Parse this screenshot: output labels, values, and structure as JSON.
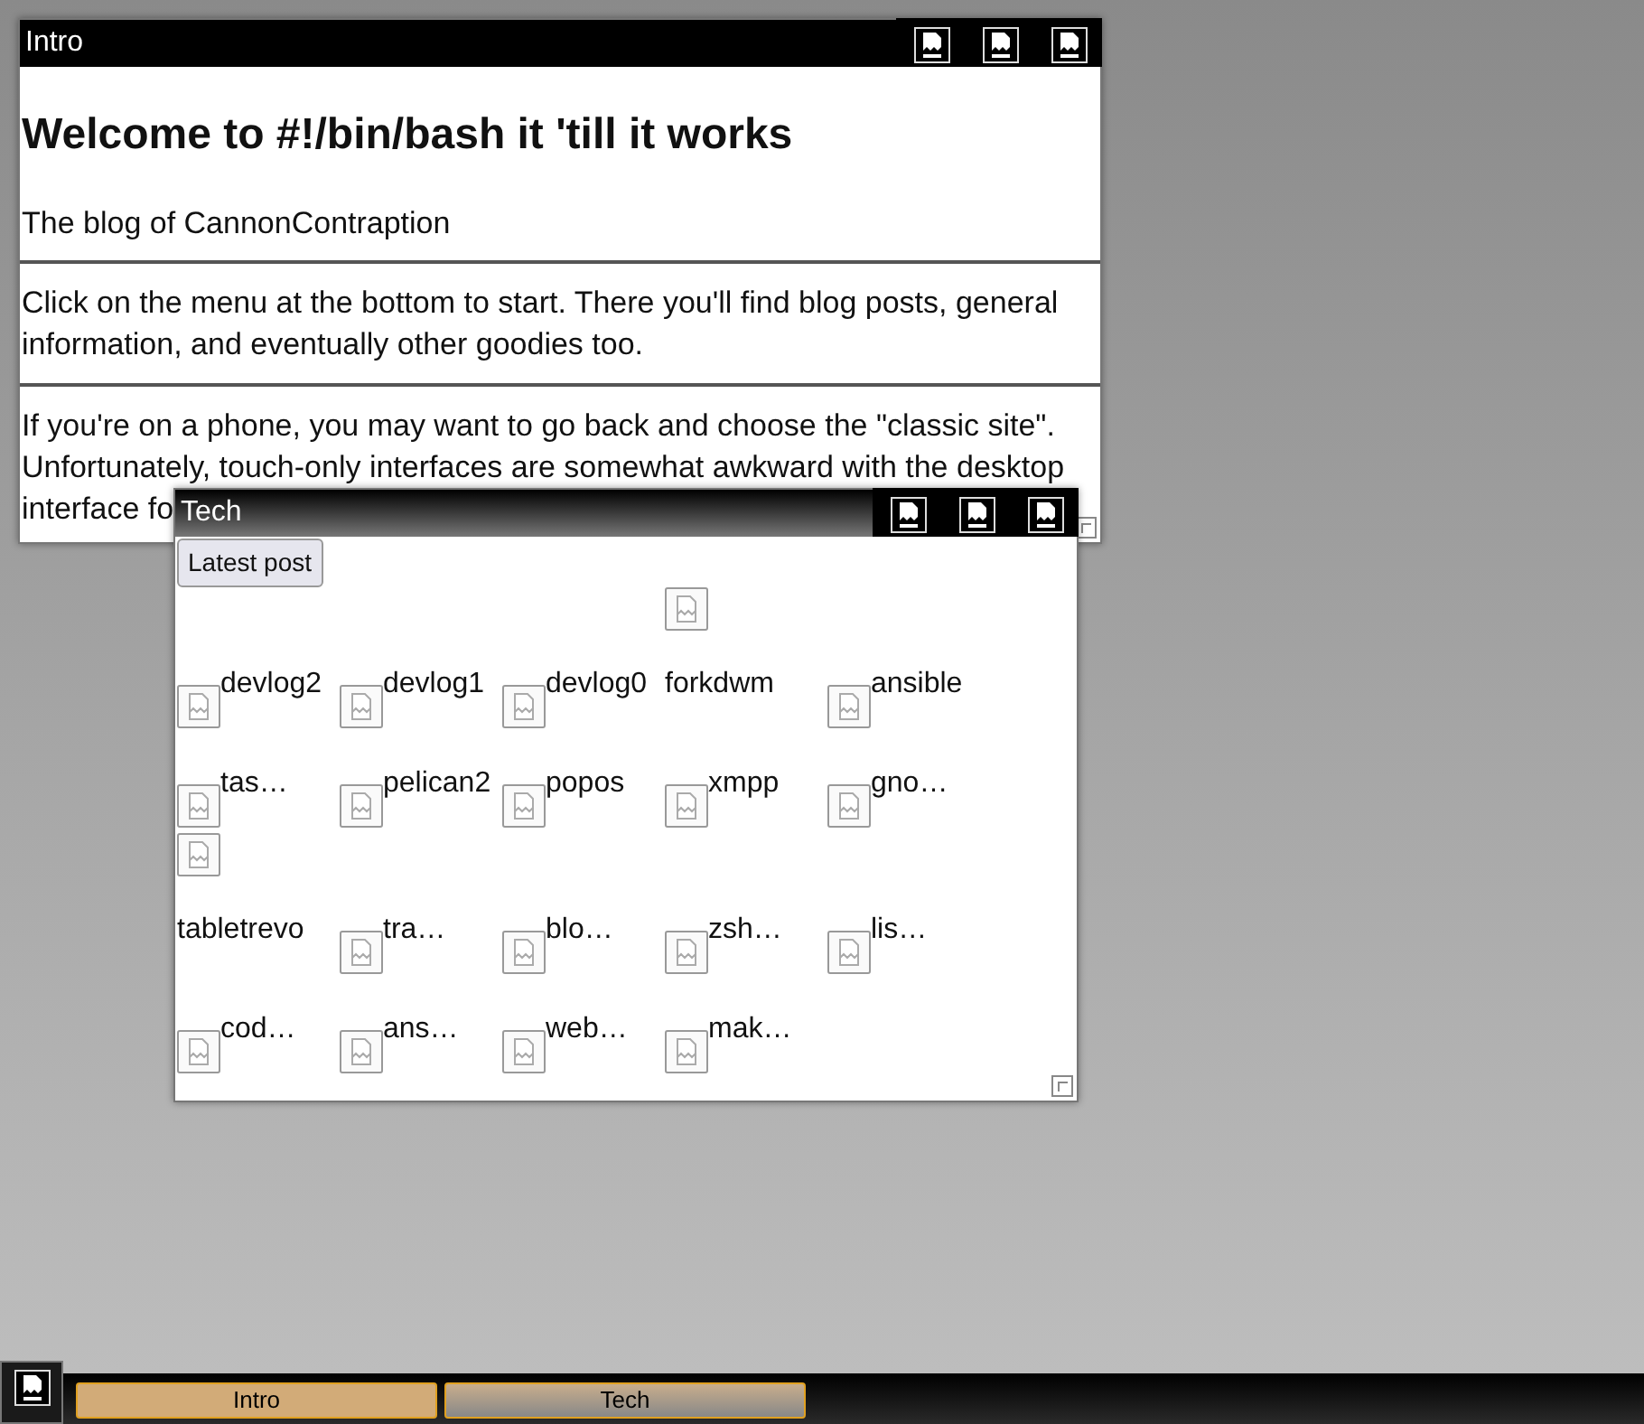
{
  "windows": [
    {
      "title": "Intro",
      "active": false,
      "heading": "Welcome to #!/bin/bash it 'till it works",
      "sections": [
        "The blog of CannonContraption",
        "Click on the menu at the bottom to start. There you'll find blog posts, general information, and eventually other goodies too.",
        "If you're on a phone, you may want to go back and choose the \"classic site\". Unfortunately, touch-only interfaces are somewhat awkward with the desktop interface fo"
      ]
    },
    {
      "title": "Tech",
      "active": true,
      "button": "Latest post",
      "grid_rows": [
        [
          {
            "kind": "blank"
          },
          {
            "kind": "blank"
          },
          {
            "kind": "blank"
          },
          {
            "kind": "image"
          },
          {
            "kind": "blank"
          }
        ],
        [
          {
            "kind": "post",
            "label": "devlog2",
            "icon": true
          },
          {
            "kind": "post",
            "label": "devlog1",
            "icon": true
          },
          {
            "kind": "post",
            "label": "devlog0",
            "icon": true
          },
          {
            "kind": "post",
            "label": "forkdwm",
            "icon": false
          },
          {
            "kind": "post",
            "label": "ansible",
            "icon": true
          }
        ],
        [
          {
            "kind": "post",
            "label": "tas…",
            "icon": true
          },
          {
            "kind": "post",
            "label": "pelican2",
            "icon": true
          },
          {
            "kind": "post",
            "label": "popos",
            "icon": true
          },
          {
            "kind": "post",
            "label": "xmpp",
            "icon": true
          },
          {
            "kind": "post",
            "label": "gno…",
            "icon": true
          }
        ],
        [
          {
            "kind": "image"
          }
        ],
        [
          {
            "kind": "post",
            "label": "tabletrevo",
            "icon": false
          },
          {
            "kind": "post",
            "label": "tra…",
            "icon": true
          },
          {
            "kind": "post",
            "label": "blo…",
            "icon": true
          },
          {
            "kind": "post",
            "label": "zsh…",
            "icon": true
          },
          {
            "kind": "post",
            "label": "lis…",
            "icon": true
          }
        ],
        [
          {
            "kind": "post",
            "label": "cod…",
            "icon": true
          },
          {
            "kind": "post",
            "label": "ans…",
            "icon": true
          },
          {
            "kind": "post",
            "label": "web…",
            "icon": true
          },
          {
            "kind": "post",
            "label": "mak…",
            "icon": true
          }
        ]
      ]
    }
  ],
  "taskbar": {
    "tasks": [
      {
        "label": "Intro",
        "selected": false
      },
      {
        "label": "Tech",
        "selected": true
      }
    ]
  }
}
